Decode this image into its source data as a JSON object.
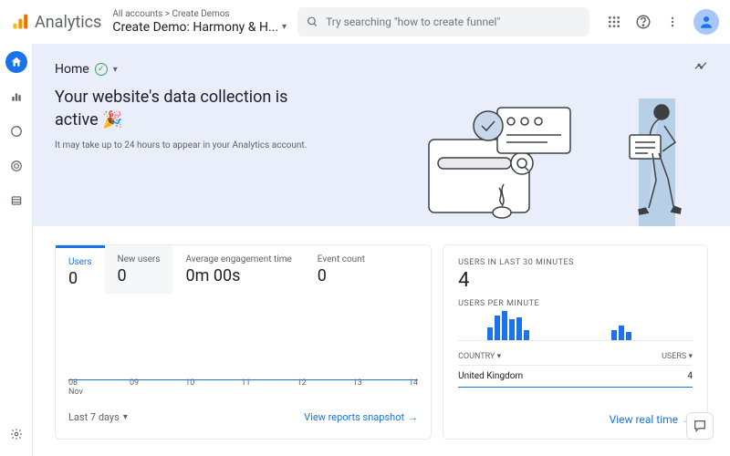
{
  "header": {
    "product": "Analytics",
    "breadcrumb_small": "All accounts > Create Demos",
    "breadcrumb_main": "Create Demo: Harmony & H...",
    "search_placeholder": "Try searching \"how to create funnel\""
  },
  "hero": {
    "home": "Home",
    "headline_a": "Your website's data collection is",
    "headline_b": "active 🎉",
    "subtext": "It may take up to 24 hours to appear in your Analytics account."
  },
  "main_card": {
    "tabs": [
      {
        "label": "Users",
        "value": "0"
      },
      {
        "label": "New users",
        "value": "0"
      },
      {
        "label": "Average engagement time",
        "value": "0m 00s"
      },
      {
        "label": "Event count",
        "value": "0"
      }
    ],
    "xaxis": [
      "08",
      "09",
      "10",
      "11",
      "12",
      "13",
      "14"
    ],
    "xaxis_month": "Nov",
    "range": "Last 7 days",
    "link": "View reports snapshot"
  },
  "side_card": {
    "label1": "Users in last 30 minutes",
    "value1": "4",
    "label2": "Users per minute",
    "col1": "Country",
    "col2": "Users",
    "row_country": "United Kingdom",
    "row_value": "4",
    "link": "View real time"
  },
  "chart_data": {
    "type": "bar",
    "title": "Users per minute",
    "categories_count": 30,
    "values": [
      0,
      0,
      0,
      0,
      12,
      24,
      28,
      20,
      22,
      10,
      0,
      0,
      0,
      0,
      0,
      0,
      0,
      0,
      0,
      0,
      0,
      10,
      14,
      8,
      0,
      0,
      0,
      0,
      0,
      0
    ],
    "ylim": [
      0,
      30
    ]
  }
}
